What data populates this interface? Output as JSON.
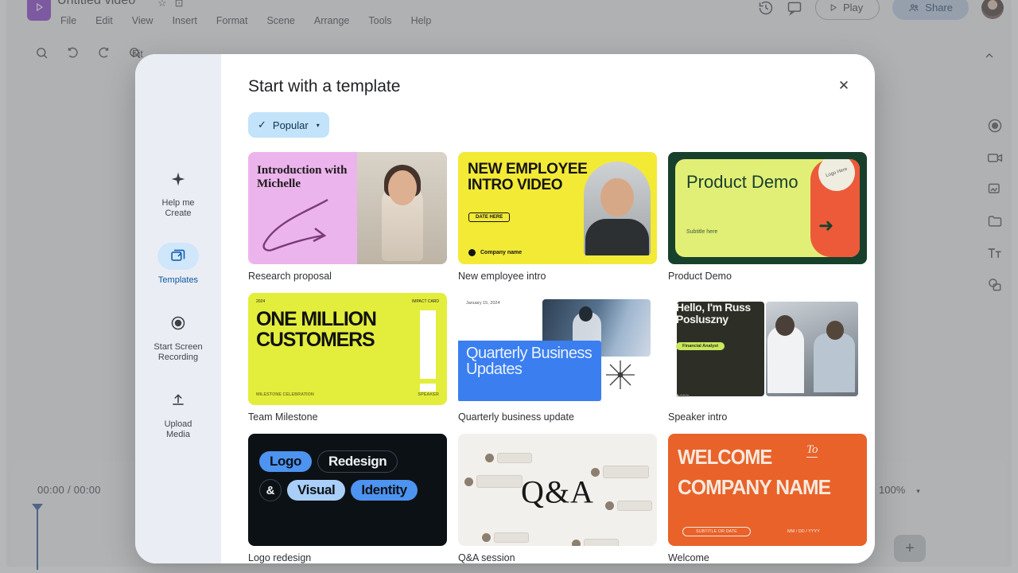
{
  "app": {
    "doc_title": "Untitled video",
    "logo_icon": "play-logo-icon",
    "star_icon": "☆",
    "move_icon": "⊡",
    "menu": [
      "File",
      "Edit",
      "View",
      "Insert",
      "Format",
      "Scene",
      "Arrange",
      "Tools",
      "Help"
    ],
    "topright": {
      "history_icon": "version-history-icon",
      "comment_icon": "comment-icon",
      "play_label": "Play",
      "share_label": "Share",
      "avatar_name": "user-avatar"
    },
    "toolbar": {
      "icons": [
        "search-icon",
        "undo-icon",
        "redo-icon",
        "zoom-icon"
      ],
      "fit_label": "Fit",
      "collapse_icon": "chevron-up-icon"
    },
    "rail_icons": [
      "record-icon",
      "camera-media-icon",
      "image-icon",
      "folder-icon",
      "text-icon",
      "shapes-icon"
    ],
    "timeline": {
      "timecode": "00:00 / 00:00",
      "zoom_level": "100%",
      "zoom_caret": "▾",
      "add_label": "+"
    }
  },
  "modal": {
    "title": "Start with a template",
    "close_icon": "✕",
    "filter": {
      "check_icon": "✓",
      "label": "Popular",
      "caret": "▾"
    },
    "sidebar": [
      {
        "icon": "sparkle-icon",
        "label": "Help me\nCreate",
        "active": false
      },
      {
        "icon": "templates-icon",
        "label": "Templates",
        "active": true
      },
      {
        "icon": "record-icon",
        "label": "Start Screen\nRecording",
        "active": false
      },
      {
        "icon": "upload-icon",
        "label": "Upload\nMedia",
        "active": false
      }
    ],
    "templates": [
      {
        "id": "research-proposal",
        "label": "Research proposal",
        "title": "Introduction with Michelle"
      },
      {
        "id": "new-employee-intro",
        "label": "New employee intro",
        "title": "NEW EMPLOYEE INTRO VIDEO",
        "date_badge": "DATE HERE",
        "company": "Company name"
      },
      {
        "id": "product-demo",
        "label": "Product Demo",
        "title": "Product Demo",
        "subtitle": "Subtitle here",
        "logo_text": "Logo Here",
        "arrow": "➜"
      },
      {
        "id": "team-milestone",
        "label": "Team Milestone",
        "title": "ONE MILLION CUSTOMERS",
        "top_left": "2024",
        "top_right": "IMPACT CARD",
        "bottom_left": "MILESTONE CELEBRATION",
        "bottom_right": "SPEAKER"
      },
      {
        "id": "quarterly-business-update",
        "label": "Quarterly business update",
        "title": "Quarterly Business Updates",
        "date": "January 15, 2024"
      },
      {
        "id": "speaker-intro",
        "label": "Speaker intro",
        "title": "Hello, I'm Russ Posluszny",
        "badge": "Financial Analyst",
        "footer": "Subtitle"
      },
      {
        "id": "logo-redesign",
        "label": "Logo redesign",
        "words": [
          "Logo",
          "Redesign",
          "&",
          "Visual",
          "Identity"
        ]
      },
      {
        "id": "qa-session",
        "label": "Q&A session",
        "title": "Q&A"
      },
      {
        "id": "welcome-company",
        "label": "Welcome",
        "line1": "WELCOME",
        "to": "To",
        "line2": "COMPANY NAME",
        "badge": "SUBTITLE OR DATE",
        "meta": "MM / DD / YYYY"
      }
    ]
  },
  "colors": {
    "accent_blue": "#3a7ef0",
    "chip_blue": "#c2e3fa",
    "active_blue": "#0b57a4",
    "brand_purple": "#8430ce",
    "share_blue": "#b8cde4"
  }
}
